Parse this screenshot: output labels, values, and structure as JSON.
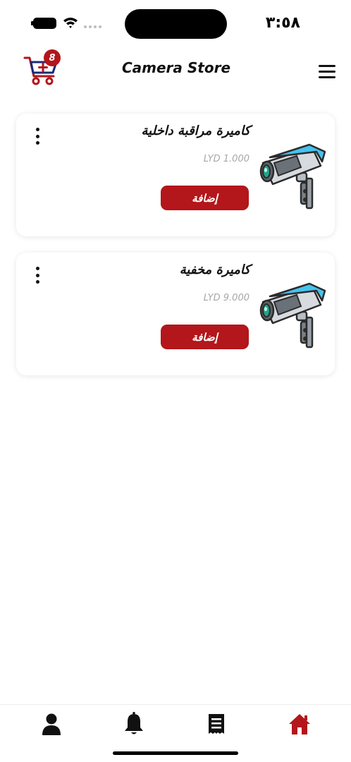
{
  "status_bar": {
    "time": "٣:٥٨",
    "icons": [
      "battery-icon",
      "wifi-icon",
      "signal-icon"
    ]
  },
  "header": {
    "title": "Camera Store",
    "cart_count": "8",
    "icons": [
      "cart-plus-icon",
      "hamburger-menu-icon"
    ]
  },
  "products": [
    {
      "name": "كاميرة مراقبة داخلية",
      "price": "LYD 1.000",
      "add_label": "إضافة"
    },
    {
      "name": "كاميرة مخفية",
      "price": "LYD 9.000",
      "add_label": "إضافة"
    }
  ],
  "bottom_nav": {
    "items": [
      "profile-icon",
      "bell-icon",
      "receipt-icon",
      "home-icon"
    ],
    "active": "home-icon"
  },
  "colors": {
    "accent": "#b3161b",
    "nav_inactive": "#111111",
    "price_text": "#a7a7a7",
    "cart_stroke": "#b3161b",
    "cart_body": "#1b2a7a"
  }
}
